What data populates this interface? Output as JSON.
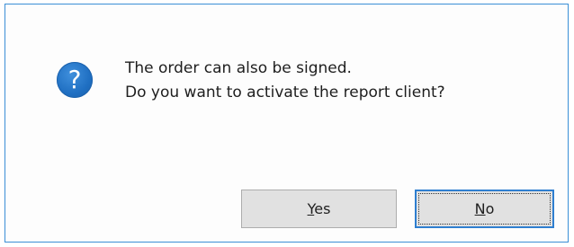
{
  "dialog": {
    "icon": "question-icon",
    "icon_glyph": "?",
    "message_line1": "The order can also be signed.",
    "message_line2": "Do you want to activate the report client?",
    "buttons": {
      "yes": {
        "mnemonic": "Y",
        "rest": "es"
      },
      "no": {
        "mnemonic": "N",
        "rest": "o"
      }
    },
    "colors": {
      "icon": "#1f6fc2",
      "focus_border": "#2f7fd0",
      "button_bg": "#e1e1e1"
    }
  }
}
